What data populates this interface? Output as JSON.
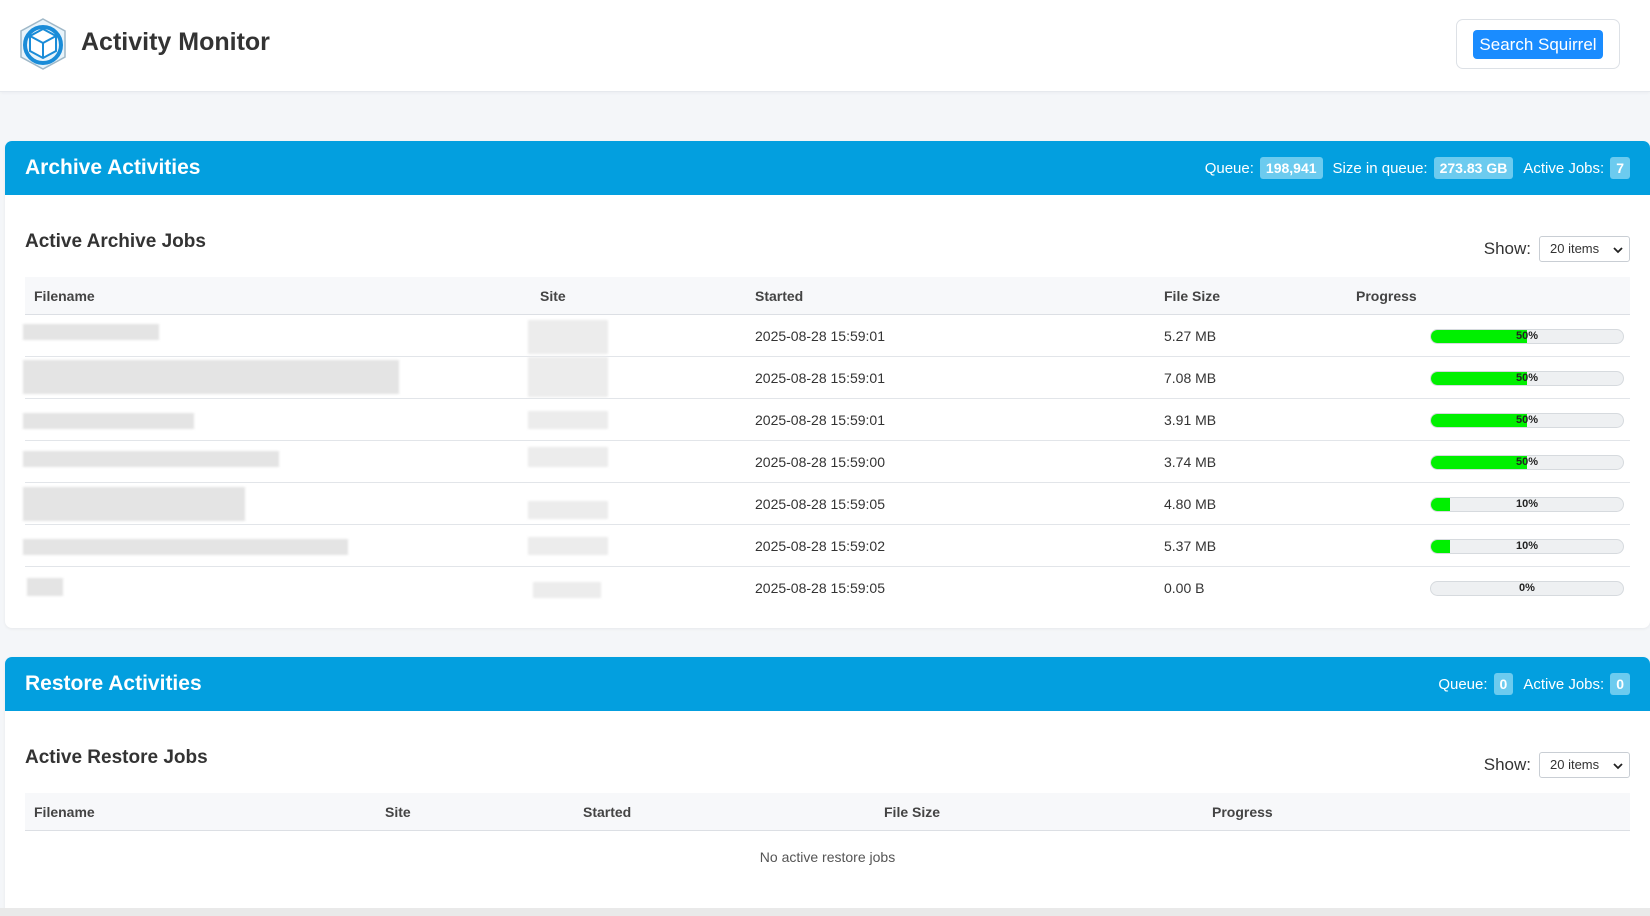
{
  "app": {
    "title": "Activity Monitor",
    "search_button": "Search Squirrel"
  },
  "archive": {
    "title": "Archive Activities",
    "stats": {
      "queue_label": "Queue:",
      "queue": "198,941",
      "size_label": "Size in queue:",
      "size": "273.83 GB",
      "active_label": "Active Jobs:",
      "active": "7"
    },
    "section_title": "Active Archive Jobs",
    "show_label": "Show:",
    "show_value": "20 items",
    "columns": [
      "Filename",
      "Site",
      "Started",
      "File Size",
      "Progress"
    ],
    "rows": [
      {
        "started": "2025-08-28 15:59:01",
        "size": "5.27 MB",
        "progress": 50,
        "progress_text": "50%"
      },
      {
        "started": "2025-08-28 15:59:01",
        "size": "7.08 MB",
        "progress": 50,
        "progress_text": "50%"
      },
      {
        "started": "2025-08-28 15:59:01",
        "size": "3.91 MB",
        "progress": 50,
        "progress_text": "50%"
      },
      {
        "started": "2025-08-28 15:59:00",
        "size": "3.74 MB",
        "progress": 50,
        "progress_text": "50%"
      },
      {
        "started": "2025-08-28 15:59:05",
        "size": "4.80 MB",
        "progress": 10,
        "progress_text": "10%"
      },
      {
        "started": "2025-08-28 15:59:02",
        "size": "5.37 MB",
        "progress": 10,
        "progress_text": "10%"
      },
      {
        "started": "2025-08-28 15:59:05",
        "size": "0.00 B",
        "progress": 0,
        "progress_text": "0%"
      }
    ]
  },
  "restore": {
    "title": "Restore Activities",
    "stats": {
      "queue_label": "Queue:",
      "queue": "0",
      "active_label": "Active Jobs:",
      "active": "0"
    },
    "section_title": "Active Restore Jobs",
    "show_label": "Show:",
    "show_value": "20 items",
    "columns": [
      "Filename",
      "Site",
      "Started",
      "File Size",
      "Progress"
    ],
    "empty_message": "No active restore jobs"
  },
  "colors": {
    "header_blue": "#039fdf",
    "badge_blue": "#6ccbef",
    "button_blue": "#1a8cff",
    "progress_green": "#00f000"
  }
}
